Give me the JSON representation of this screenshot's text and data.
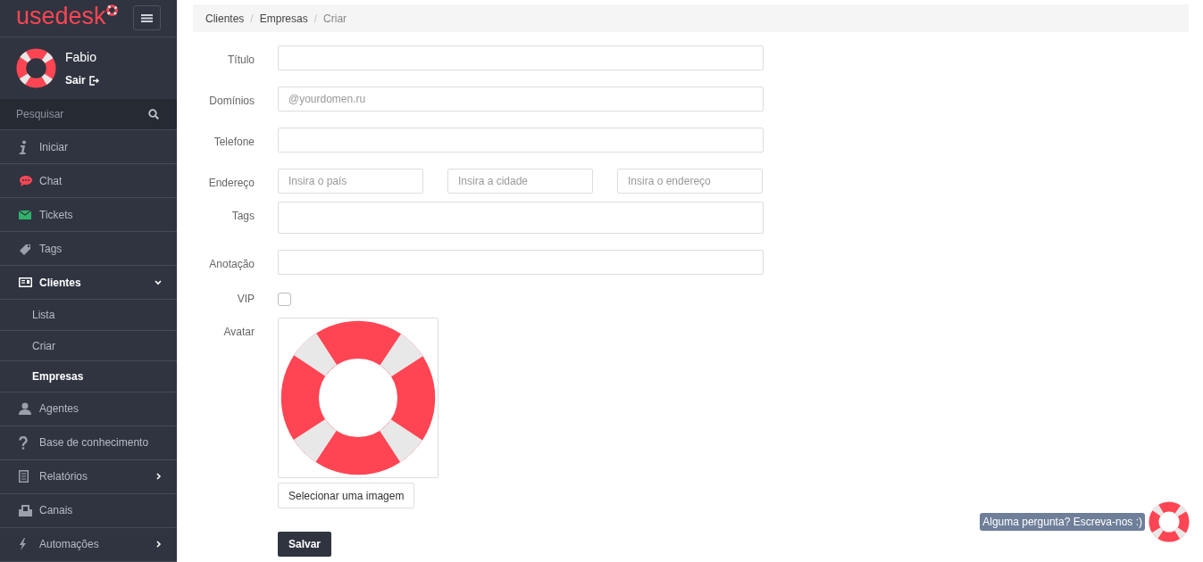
{
  "sidebar": {
    "logo": "usedesk",
    "user": {
      "name": "Fabio",
      "logout": "Sair"
    },
    "search": {
      "placeholder": "Pesquisar"
    },
    "items": [
      {
        "label": "Iniciar"
      },
      {
        "label": "Chat"
      },
      {
        "label": "Tickets"
      },
      {
        "label": "Tags"
      },
      {
        "label": "Clientes",
        "expanded": true,
        "children": [
          {
            "label": "Lista",
            "selected": false
          },
          {
            "label": "Criar",
            "selected": false
          },
          {
            "label": "Empresas",
            "selected": true
          }
        ]
      },
      {
        "label": "Agentes"
      },
      {
        "label": "Base de conhecimento"
      },
      {
        "label": "Relatórios",
        "expanded": false
      },
      {
        "label": "Canais"
      },
      {
        "label": "Automações",
        "expanded": false
      }
    ]
  },
  "breadcrumb_separator": "/",
  "breadcrumb": [
    {
      "label": "Clientes",
      "current": false
    },
    {
      "label": "Empresas",
      "current": false
    },
    {
      "label": "Criar",
      "current": true
    }
  ],
  "form": {
    "fields": [
      {
        "kind": "text",
        "label": "Título"
      },
      {
        "kind": "text",
        "label": "Domínios",
        "placeholder": "@yourdomen.ru"
      },
      {
        "kind": "text",
        "label": "Telefone"
      },
      {
        "kind": "address",
        "label": "Endereço",
        "placeholders": [
          "Insira o país",
          "Insira a cidade",
          "Insira o endereço"
        ]
      },
      {
        "kind": "tall",
        "label": "Tags"
      },
      {
        "kind": "text",
        "label": "Anotação"
      },
      {
        "kind": "checkbox",
        "label": "VIP",
        "checked": false
      },
      {
        "kind": "avatar",
        "label": "Avatar",
        "button": "Selecionar uma imagem"
      }
    ],
    "submit": "Salvar"
  },
  "chat_widget": {
    "text": "Alguma pergunta? Escreva-nos :)"
  }
}
